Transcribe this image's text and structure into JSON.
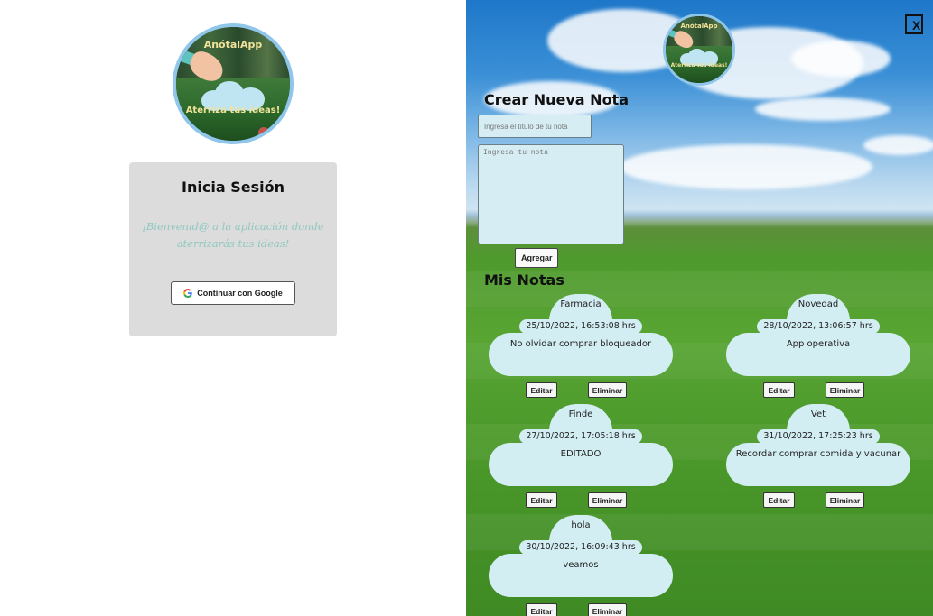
{
  "login": {
    "logo_title": "AnótalApp",
    "logo_tagline": "Aterriza tus ideas!",
    "title": "Inicia Sesión",
    "welcome_text": "¡Bienvenid@ a la aplicación donde aterrizarás tus ideas!",
    "google_button_label": "Continuar con Google"
  },
  "notes_panel": {
    "logo_title": "AnótalApp",
    "logo_tagline": "Aterriza tus ideas!",
    "close_label": "X",
    "create_title": "Crear Nueva Nota",
    "title_placeholder": "Ingresa el título de tu nota",
    "note_placeholder": "Ingresa tu nota",
    "add_button_label": "Agregar",
    "my_notes_title": "Mis Notas",
    "edit_label": "Editar",
    "delete_label": "Eliminar",
    "notes": [
      {
        "title": "Farmacia",
        "date": "25/10/2022, 16:53:08 hrs",
        "body": "No olvidar comprar bloqueador"
      },
      {
        "title": "Novedad",
        "date": "28/10/2022, 13:06:57 hrs",
        "body": "App operativa"
      },
      {
        "title": "Finde",
        "date": "27/10/2022, 17:05:18 hrs",
        "body": "EDITADO"
      },
      {
        "title": "Vet",
        "date": "31/10/2022, 17:25:23 hrs",
        "body": "Recordar comprar comida y vacunar"
      },
      {
        "title": "hola",
        "date": "30/10/2022, 16:09:43 hrs",
        "body": "veamos"
      }
    ]
  },
  "colors": {
    "note_bubble": "#d3eef3",
    "login_card": "#dcdcdc",
    "welcome_text": "#8fc8c0",
    "logo_border": "#8fc6ea"
  }
}
